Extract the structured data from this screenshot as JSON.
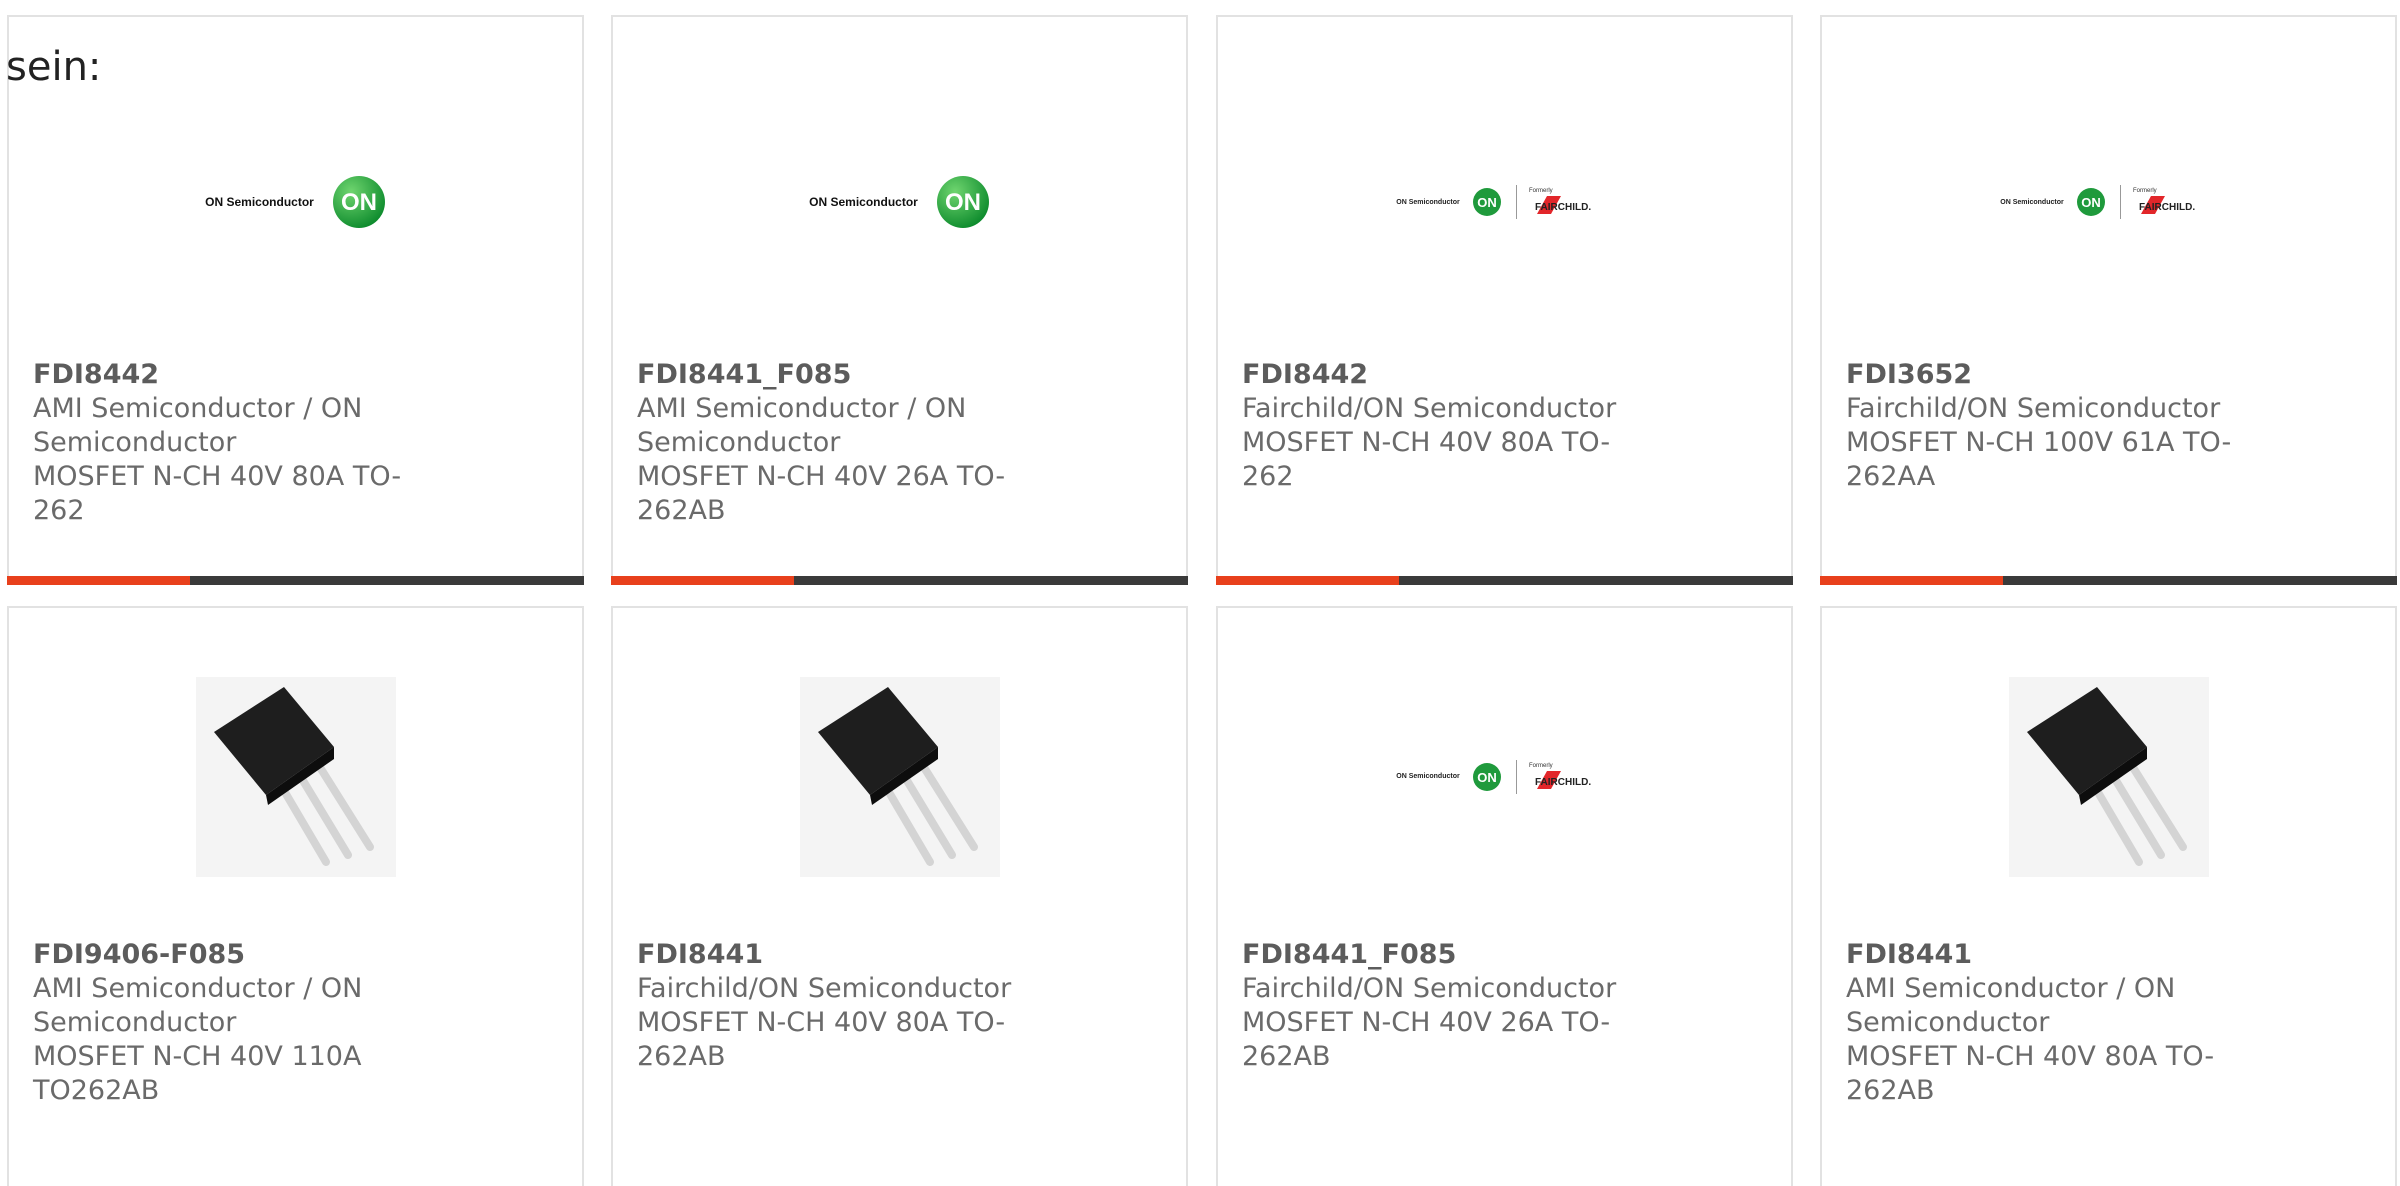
{
  "intro_text": "sein:",
  "colors": {
    "accent": "#e8401c",
    "bar": "#3a3a3a",
    "border": "#e2e2e2",
    "text": "#6a6a6a"
  },
  "logo_text": {
    "on_semi": "ON Semiconductor",
    "on_badge": "ON",
    "formerly": "Formerly",
    "fairchild": "FAIRCHILD."
  },
  "cards": [
    {
      "part": "FDI8442",
      "manufacturer": "AMI Semiconductor / ON Semiconductor",
      "description": "MOSFET N-CH 40V 80A TO-262",
      "image": "on-semiconductor-logo"
    },
    {
      "part": "FDI8441_F085",
      "manufacturer": "AMI Semiconductor / ON Semiconductor",
      "description": "MOSFET N-CH 40V 26A TO-262AB",
      "image": "on-semiconductor-logo"
    },
    {
      "part": "FDI8442",
      "manufacturer": "Fairchild/ON Semiconductor",
      "description": "MOSFET N-CH 40V 80A TO-262",
      "image": "on-fairchild-logo"
    },
    {
      "part": "FDI3652",
      "manufacturer": "Fairchild/ON Semiconductor",
      "description": "MOSFET N-CH 100V 61A TO-262AA",
      "image": "on-fairchild-logo"
    },
    {
      "part": "FDI9406-F085",
      "manufacturer": "AMI Semiconductor / ON Semiconductor",
      "description": "MOSFET N-CH 40V 110A TO262AB",
      "image": "to262-package-photo"
    },
    {
      "part": "FDI8441",
      "manufacturer": "Fairchild/ON Semiconductor",
      "description": "MOSFET N-CH 40V 80A TO-262AB",
      "image": "to262-package-photo"
    },
    {
      "part": "FDI8441_F085",
      "manufacturer": "Fairchild/ON Semiconductor",
      "description": "MOSFET N-CH 40V 26A TO-262AB",
      "image": "on-fairchild-logo"
    },
    {
      "part": "FDI8441",
      "manufacturer": "AMI Semiconductor / ON Semiconductor",
      "description": "MOSFET N-CH 40V 80A TO-262AB",
      "image": "to262-package-photo"
    }
  ]
}
